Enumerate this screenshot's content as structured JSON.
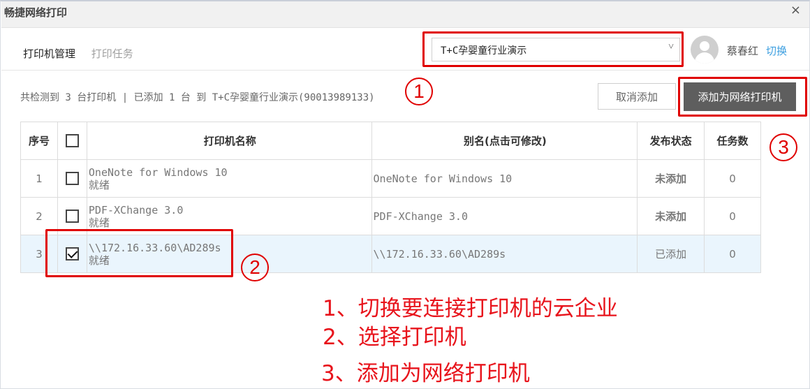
{
  "window": {
    "title": "畅捷网络打印",
    "close_label": "×"
  },
  "tabs": [
    {
      "label": "打印机管理",
      "active": true
    },
    {
      "label": "打印任务",
      "active": false
    }
  ],
  "enterprise_select": {
    "value": "T+C孕婴童行业演示",
    "chevron": "˅"
  },
  "user": {
    "name": "蔡春红",
    "switch_label": "切换"
  },
  "status_text": "共检测到 3 台打印机 | 已添加 1 台 到 T+C孕婴童行业演示(90013989133)",
  "buttons": {
    "cancel_add": "取消添加",
    "add_network": "添加为网络打印机"
  },
  "table": {
    "headers": {
      "index": "序号",
      "name": "打印机名称",
      "alias": "别名(点击可修改)",
      "state": "发布状态",
      "tasks": "任务数"
    },
    "rows": [
      {
        "index": "1",
        "checked": false,
        "name": "OneNote for Windows 10",
        "status": "就绪",
        "alias": "OneNote for Windows 10",
        "state": "未添加",
        "tasks": "0"
      },
      {
        "index": "2",
        "checked": false,
        "name": "PDF-XChange 3.0",
        "status": "就绪",
        "alias": "PDF-XChange 3.0",
        "state": "未添加",
        "tasks": "0"
      },
      {
        "index": "3",
        "checked": true,
        "name": "\\\\172.16.33.60\\AD289s",
        "status": "就绪",
        "alias": "\\\\172.16.33.60\\AD289s",
        "state": "已添加",
        "tasks": "0"
      }
    ]
  },
  "annotations": {
    "marker1": "1",
    "marker2": "2",
    "marker3": "3",
    "step1": "1、切换要连接打印机的云企业",
    "step2": "2、选择打印机",
    "step3": "3、添加为网络打印机"
  },
  "colors": {
    "accent_link": "#3d9fe0",
    "added_state": "#5cc7a8",
    "annotation_red": "#e00000",
    "primary_button": "#5e5e5e",
    "selected_row": "#eaf5fd"
  },
  "icons": {
    "avatar": "user-avatar-icon",
    "close": "close-icon",
    "chevron": "chevron-down-icon"
  }
}
